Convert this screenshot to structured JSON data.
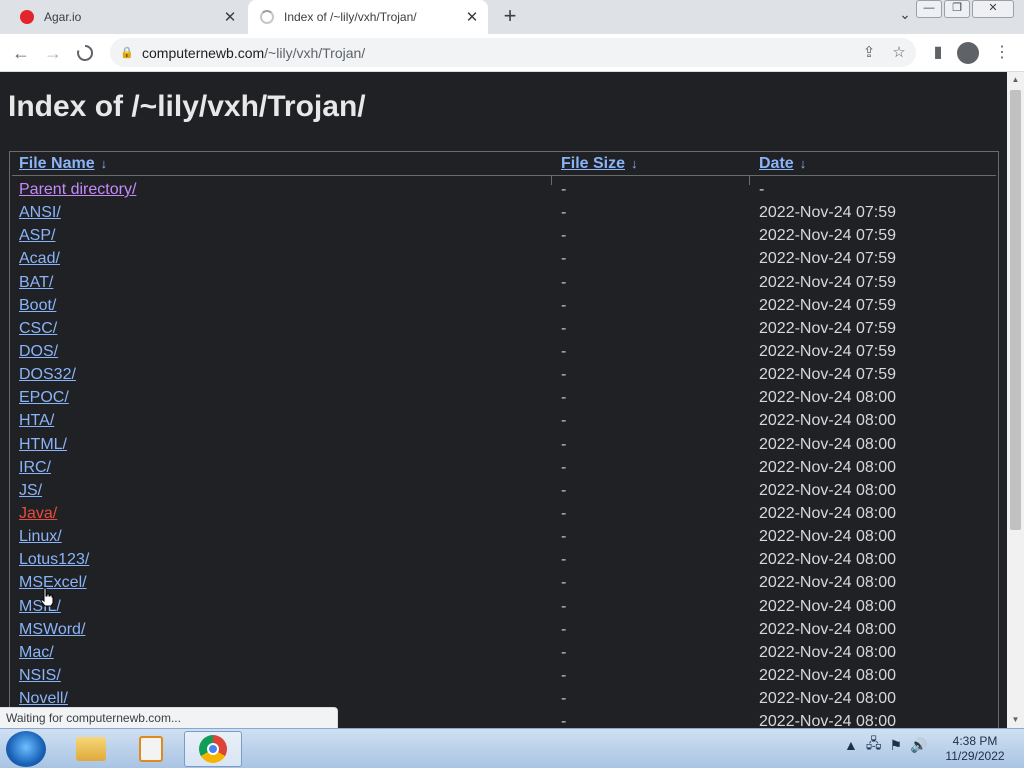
{
  "tabs": [
    {
      "title": "Agar.io",
      "favicon": "agar-icon"
    },
    {
      "title": "Index of /~lily/vxh/Trojan/",
      "favicon": "loading-spinner-icon"
    }
  ],
  "window_controls": {
    "minimize": "—",
    "restore": "❐",
    "close": "✕"
  },
  "toolbar": {
    "url_host": "computernewb.com",
    "url_path": "/~lily/vxh/Trojan/"
  },
  "page": {
    "heading": "Index of /~lily/vxh/Trojan/",
    "columns": {
      "name": "File Name",
      "size": "File Size",
      "date": "Date",
      "sort_arrow": "↓"
    },
    "rows": [
      {
        "name": "Parent directory/",
        "size": "-",
        "date": "-"
      },
      {
        "name": "ANSI/",
        "size": "-",
        "date": "2022-Nov-24 07:59"
      },
      {
        "name": "ASP/",
        "size": "-",
        "date": "2022-Nov-24 07:59"
      },
      {
        "name": "Acad/",
        "size": "-",
        "date": "2022-Nov-24 07:59"
      },
      {
        "name": "BAT/",
        "size": "-",
        "date": "2022-Nov-24 07:59"
      },
      {
        "name": "Boot/",
        "size": "-",
        "date": "2022-Nov-24 07:59"
      },
      {
        "name": "CSC/",
        "size": "-",
        "date": "2022-Nov-24 07:59"
      },
      {
        "name": "DOS/",
        "size": "-",
        "date": "2022-Nov-24 07:59"
      },
      {
        "name": "DOS32/",
        "size": "-",
        "date": "2022-Nov-24 07:59"
      },
      {
        "name": "EPOC/",
        "size": "-",
        "date": "2022-Nov-24 08:00"
      },
      {
        "name": "HTA/",
        "size": "-",
        "date": "2022-Nov-24 08:00"
      },
      {
        "name": "HTML/",
        "size": "-",
        "date": "2022-Nov-24 08:00"
      },
      {
        "name": "IRC/",
        "size": "-",
        "date": "2022-Nov-24 08:00"
      },
      {
        "name": "JS/",
        "size": "-",
        "date": "2022-Nov-24 08:00"
      },
      {
        "name": "Java/",
        "size": "-",
        "date": "2022-Nov-24 08:00"
      },
      {
        "name": "Linux/",
        "size": "-",
        "date": "2022-Nov-24 08:00"
      },
      {
        "name": "Lotus123/",
        "size": "-",
        "date": "2022-Nov-24 08:00"
      },
      {
        "name": "MSExcel/",
        "size": "-",
        "date": "2022-Nov-24 08:00"
      },
      {
        "name": "MSIL/",
        "size": "-",
        "date": "2022-Nov-24 08:00"
      },
      {
        "name": "MSWord/",
        "size": "-",
        "date": "2022-Nov-24 08:00"
      },
      {
        "name": "Mac/",
        "size": "-",
        "date": "2022-Nov-24 08:00"
      },
      {
        "name": "NSIS/",
        "size": "-",
        "date": "2022-Nov-24 08:00"
      },
      {
        "name": "Novell/",
        "size": "-",
        "date": "2022-Nov-24 08:00"
      },
      {
        "name": "",
        "size": "-",
        "date": "2022-Nov-24 08:00"
      }
    ]
  },
  "status_bar": {
    "text": "Waiting for computernewb.com..."
  },
  "taskbar": {
    "items": [
      "windows-explorer-icon",
      "media-player-icon",
      "chrome-icon"
    ],
    "clock_time": "4:38 PM",
    "clock_date": "11/29/2022"
  },
  "colors": {
    "link": "#8ab4f8",
    "visited": "#c58af9",
    "hover": "#e74c3c",
    "page_bg": "#202124"
  }
}
